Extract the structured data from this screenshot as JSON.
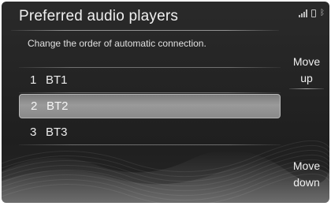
{
  "header": {
    "title": "Preferred audio players",
    "status_icons": [
      "signal-strength-icon",
      "phone-battery-icon",
      "bluetooth-icon"
    ]
  },
  "subtitle": "Change the order of automatic connection.",
  "players": [
    {
      "number": "1",
      "name": "BT1",
      "selected": false
    },
    {
      "number": "2",
      "name": "BT2",
      "selected": true
    },
    {
      "number": "3",
      "name": "BT3",
      "selected": false
    }
  ],
  "buttons": {
    "move_up_line1": "Move",
    "move_up_line2": "up",
    "move_down_line1": "Move",
    "move_down_line2": "down"
  },
  "colors": {
    "background": "#232323",
    "selected_row": "#8a8a8a",
    "text": "#ececec"
  }
}
